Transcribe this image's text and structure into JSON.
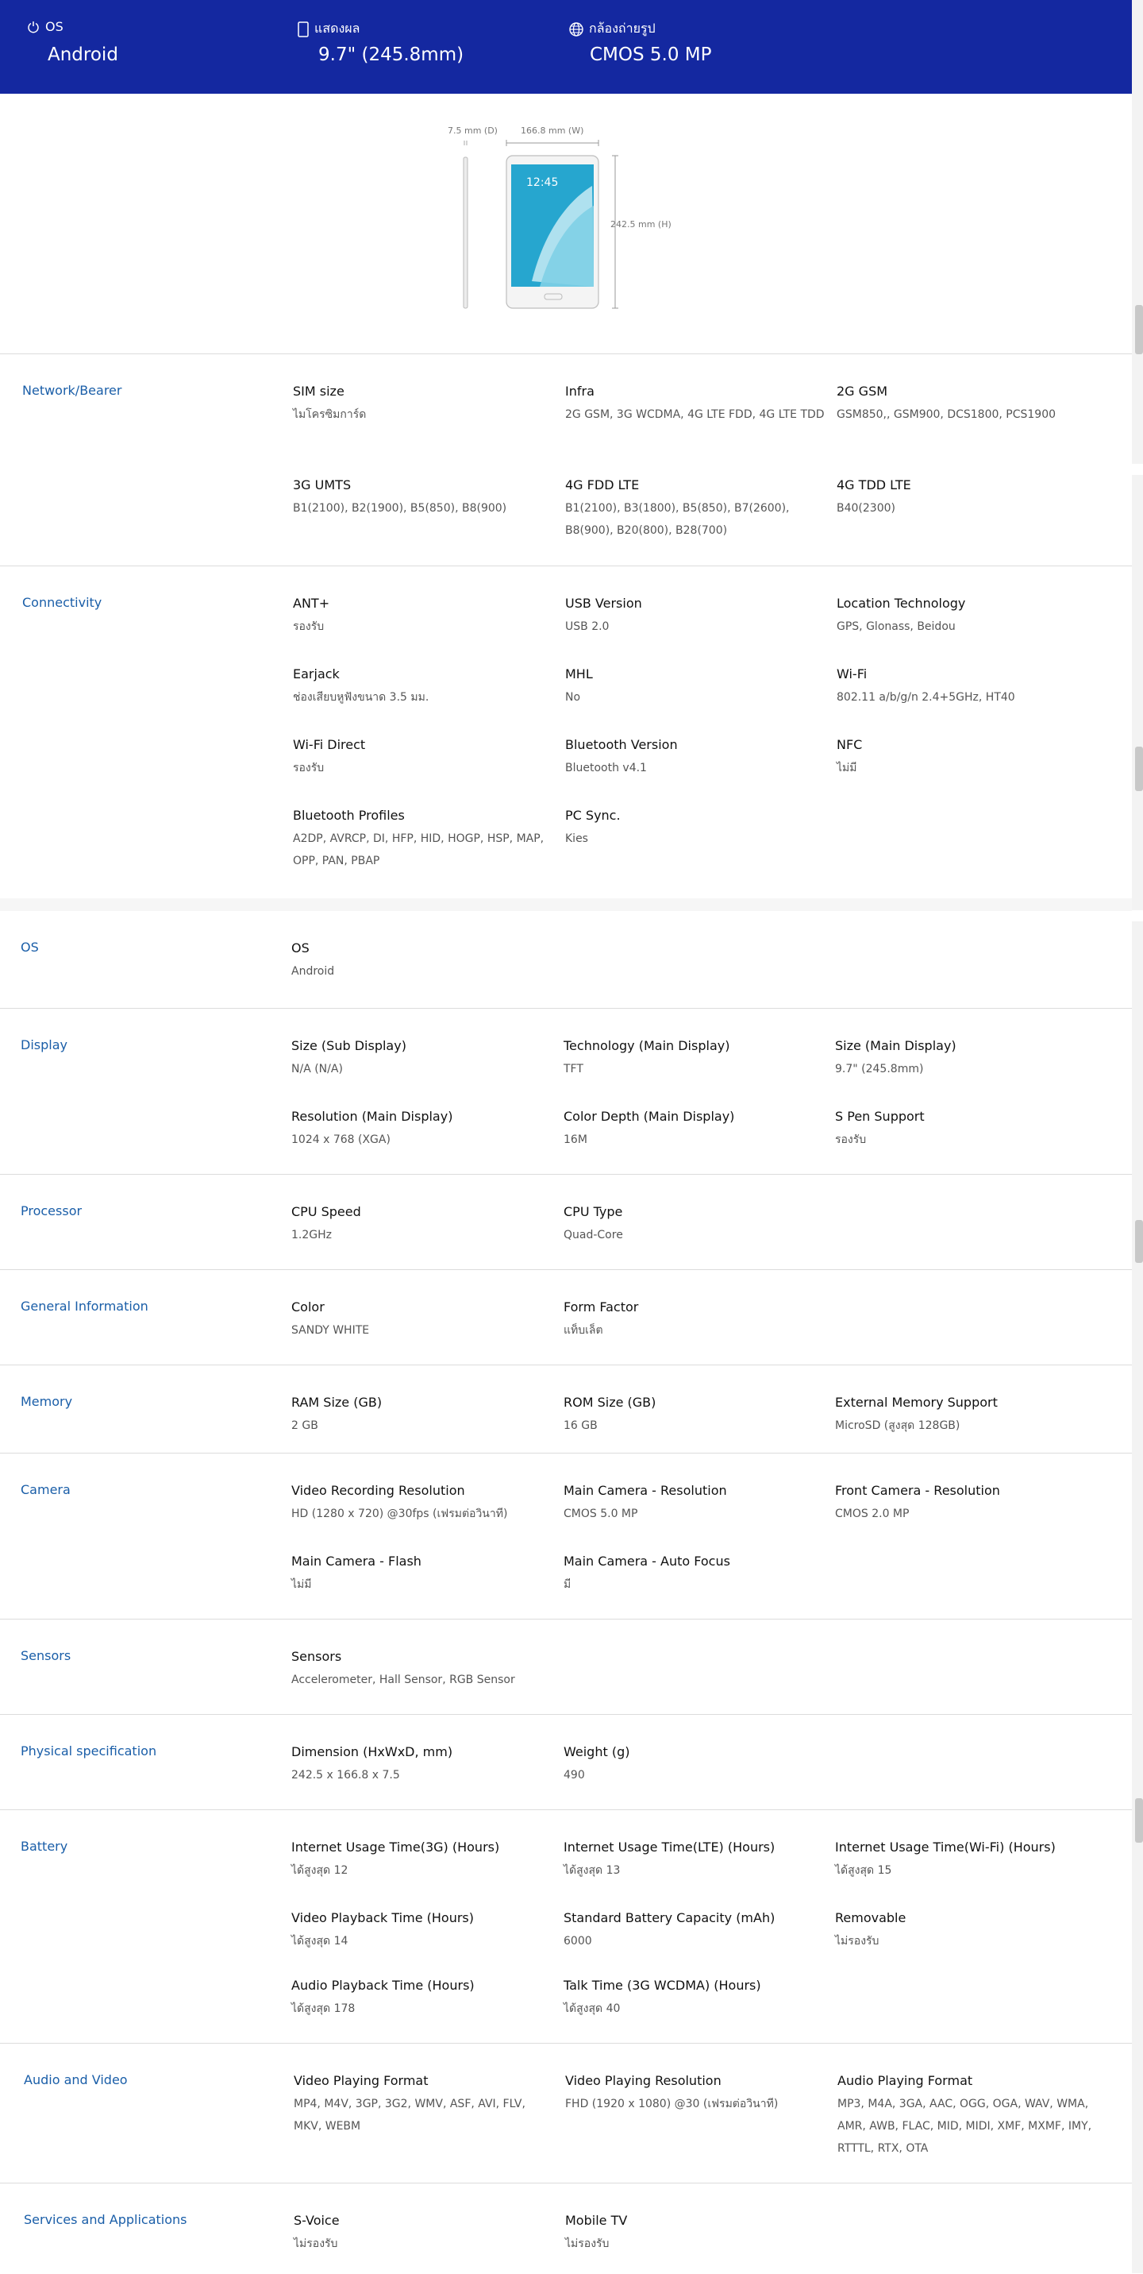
{
  "highlights": [
    {
      "icon": "power-icon",
      "label": "OS",
      "value": "Android"
    },
    {
      "icon": "display-icon",
      "label": "แสดงผล",
      "value": "9.7\" (245.8mm)"
    },
    {
      "icon": "globe-icon",
      "label": "กล้องถ่ายรูป",
      "value": "CMOS 5.0 MP"
    }
  ],
  "dimensions": {
    "depth": "7.5 mm (D)",
    "width": "166.8 mm (W)",
    "height": "242.5 mm (H)",
    "screen_time": "12:45"
  },
  "sections": [
    {
      "title": "Network/Bearer",
      "specs": [
        {
          "k": "SIM size",
          "v": "ไมโครซิมการ์ด"
        },
        {
          "k": "Infra",
          "v": "2G GSM, 3G WCDMA, 4G LTE FDD, 4G LTE TDD"
        },
        {
          "k": "2G GSM",
          "v": "GSM850,, GSM900, DCS1800, PCS1900"
        },
        {
          "k": "3G UMTS",
          "v": "B1(2100), B2(1900), B5(850), B8(900)"
        },
        {
          "k": "4G FDD LTE",
          "v": "B1(2100), B3(1800), B5(850), B7(2600), B8(900), B20(800), B28(700)"
        },
        {
          "k": "4G TDD LTE",
          "v": "B40(2300)"
        }
      ]
    },
    {
      "title": "Connectivity",
      "specs": [
        {
          "k": "ANT+",
          "v": "รองรับ"
        },
        {
          "k": "USB Version",
          "v": "USB 2.0"
        },
        {
          "k": "Location Technology",
          "v": "GPS, Glonass, Beidou"
        },
        {
          "k": "Earjack",
          "v": "ช่องเสียบหูฟังขนาด 3.5 มม."
        },
        {
          "k": "MHL",
          "v": "No"
        },
        {
          "k": "Wi-Fi",
          "v": "802.11 a/b/g/n 2.4+5GHz, HT40"
        },
        {
          "k": "Wi-Fi Direct",
          "v": "รองรับ"
        },
        {
          "k": "Bluetooth Version",
          "v": "Bluetooth v4.1"
        },
        {
          "k": "NFC",
          "v": "ไม่มี"
        },
        {
          "k": "Bluetooth Profiles",
          "v": "A2DP, AVRCP, DI, HFP, HID, HOGP, HSP, MAP, OPP, PAN, PBAP"
        },
        {
          "k": "PC Sync.",
          "v": "Kies"
        }
      ]
    },
    {
      "title": "OS",
      "specs": [
        {
          "k": "OS",
          "v": "Android"
        }
      ]
    },
    {
      "title": "Display",
      "specs": [
        {
          "k": "Size (Sub Display)",
          "v": "N/A (N/A)"
        },
        {
          "k": "Technology (Main Display)",
          "v": "TFT"
        },
        {
          "k": "Size (Main Display)",
          "v": "9.7\" (245.8mm)"
        },
        {
          "k": "Resolution (Main Display)",
          "v": "1024 x 768 (XGA)"
        },
        {
          "k": "Color Depth (Main Display)",
          "v": "16M"
        },
        {
          "k": "S Pen Support",
          "v": "รองรับ"
        }
      ]
    },
    {
      "title": "Processor",
      "specs": [
        {
          "k": "CPU Speed",
          "v": "1.2GHz"
        },
        {
          "k": "CPU Type",
          "v": "Quad-Core"
        }
      ]
    },
    {
      "title": "General Information",
      "specs": [
        {
          "k": "Color",
          "v": "SANDY WHITE"
        },
        {
          "k": "Form Factor",
          "v": "แท็บเล็ต"
        }
      ]
    },
    {
      "title": "Memory",
      "specs": [
        {
          "k": "RAM Size (GB)",
          "v": "2 GB"
        },
        {
          "k": "ROM Size (GB)",
          "v": "16 GB"
        },
        {
          "k": "External Memory Support",
          "v": "MicroSD (สูงสุด 128GB)"
        }
      ]
    },
    {
      "title": "Camera",
      "specs": [
        {
          "k": "Video Recording Resolution",
          "v": "HD (1280 x 720) @30fps (เฟรมต่อวินาที)"
        },
        {
          "k": "Main Camera - Resolution",
          "v": "CMOS 5.0 MP"
        },
        {
          "k": "Front Camera - Resolution",
          "v": "CMOS 2.0 MP"
        },
        {
          "k": "Main Camera - Flash",
          "v": "ไม่มี"
        },
        {
          "k": "Main Camera - Auto Focus",
          "v": "มี"
        }
      ]
    },
    {
      "title": "Sensors",
      "specs": [
        {
          "k": "Sensors",
          "v": "Accelerometer, Hall Sensor, RGB Sensor"
        }
      ]
    },
    {
      "title": "Physical specification",
      "specs": [
        {
          "k": "Dimension (HxWxD, mm)",
          "v": "242.5 x 166.8 x 7.5"
        },
        {
          "k": "Weight (g)",
          "v": "490"
        }
      ]
    },
    {
      "title": "Battery",
      "specs": [
        {
          "k": "Internet Usage Time(3G) (Hours)",
          "v": "ได้สูงสุด 12"
        },
        {
          "k": "Internet Usage Time(LTE) (Hours)",
          "v": "ได้สูงสุด 13"
        },
        {
          "k": "Internet Usage Time(Wi-Fi) (Hours)",
          "v": "ได้สูงสุด 15"
        },
        {
          "k": "Video Playback Time (Hours)",
          "v": "ได้สูงสุด 14"
        },
        {
          "k": "Standard Battery Capacity (mAh)",
          "v": "6000"
        },
        {
          "k": "Removable",
          "v": "ไม่รองรับ"
        },
        {
          "k": "Audio Playback Time (Hours)",
          "v": "ได้สูงสุด 178"
        },
        {
          "k": "Talk Time (3G WCDMA) (Hours)",
          "v": "ได้สูงสุด 40"
        }
      ]
    },
    {
      "title": "Audio and Video",
      "specs": [
        {
          "k": "Video Playing Format",
          "v": "MP4, M4V, 3GP, 3G2, WMV, ASF, AVI, FLV, MKV, WEBM"
        },
        {
          "k": "Video Playing Resolution",
          "v": "FHD (1920 x 1080) @30 (เฟรมต่อวินาที)"
        },
        {
          "k": "Audio Playing Format",
          "v": "MP3, M4A, 3GA, AAC, OGG, OGA, WAV, WMA, AMR, AWB, FLAC, MID, MIDI, XMF, MXMF, IMY, RTTTL, RTX, OTA"
        }
      ]
    },
    {
      "title": "Services and Applications",
      "specs": [
        {
          "k": "S-Voice",
          "v": "ไม่รองรับ"
        },
        {
          "k": "Mobile TV",
          "v": "ไม่รองรับ"
        }
      ]
    }
  ]
}
